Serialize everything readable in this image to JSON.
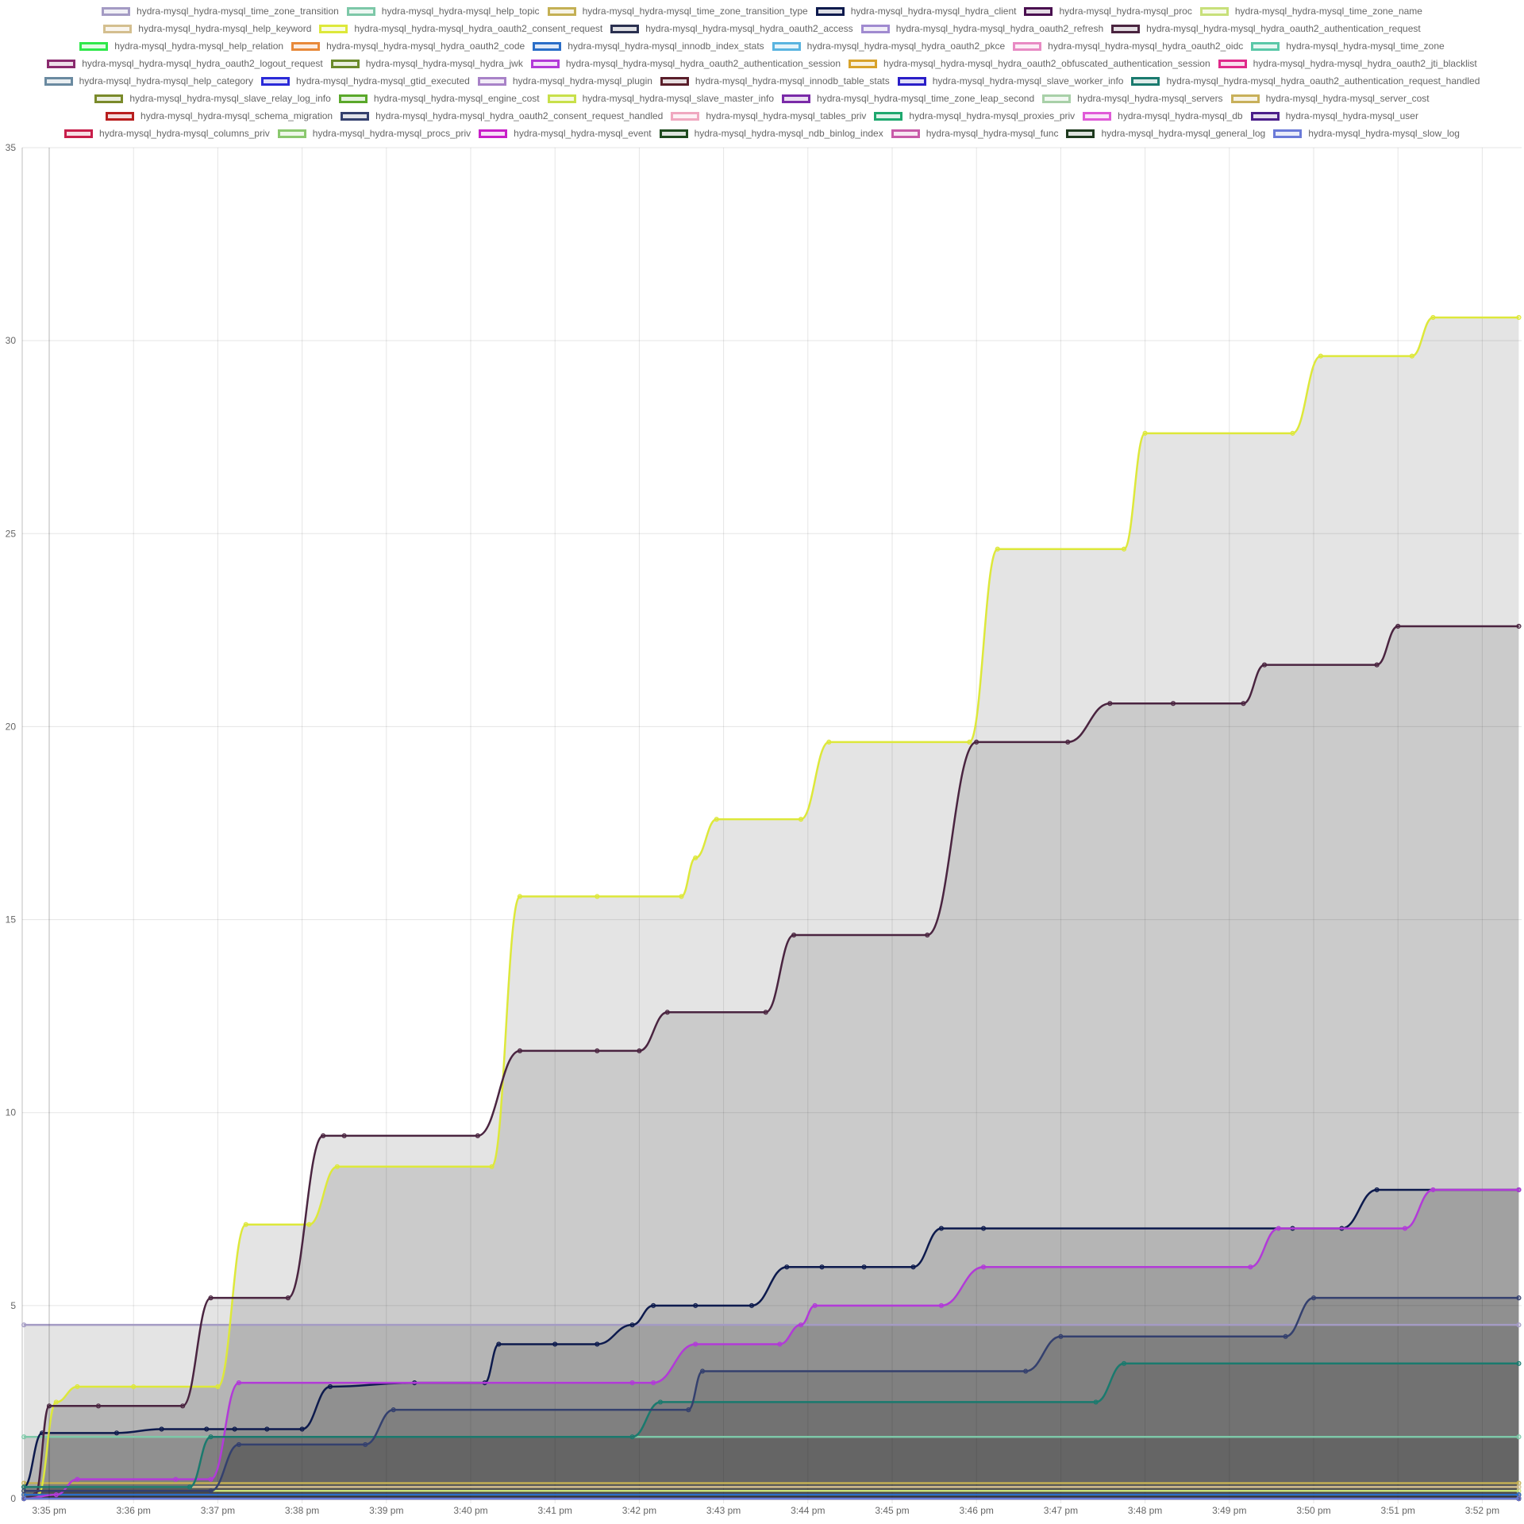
{
  "chart_data": {
    "type": "area",
    "title": "",
    "xlabel": "",
    "ylabel": "",
    "ylim": [
      0,
      35
    ],
    "y_ticks": [
      "0",
      "5",
      "10",
      "15",
      "20",
      "25",
      "30",
      "35"
    ],
    "x_ticks": [
      "3:35 pm",
      "3:36 pm",
      "3:37 pm",
      "3:38 pm",
      "3:39 pm",
      "3:40 pm",
      "3:41 pm",
      "3:42 pm",
      "3:43 pm",
      "3:44 pm",
      "3:45 pm",
      "3:46 pm",
      "3:47 pm",
      "3:48 pm",
      "3:49 pm",
      "3:50 pm",
      "3:51 pm",
      "3:52 pm"
    ],
    "x_unit": "time",
    "grid": true,
    "legend_position": "top",
    "series": [
      {
        "name": "hydra-mysql_hydra-mysql_time_zone_transition",
        "color": "#a49bc4",
        "x": [
          "3:34:42 pm",
          "3:52:26 pm"
        ],
        "y": [
          4.5,
          4.5
        ]
      },
      {
        "name": "hydra-mysql_hydra-mysql_help_topic",
        "color": "#7dc8a8",
        "x": [
          "3:34:42 pm",
          "3:52:26 pm"
        ],
        "y": [
          1.6,
          1.6
        ]
      },
      {
        "name": "hydra-mysql_hydra-mysql_time_zone_transition_type",
        "color": "#c4b054",
        "x": [
          "3:34:42 pm",
          "3:52:26 pm"
        ],
        "y": [
          0.4,
          0.4
        ]
      },
      {
        "name": "hydra-mysql_hydra-mysql_hydra_client",
        "color": "#0d1a4d",
        "x": [
          "3:34:42 pm",
          "3:34:55 pm",
          "3:35:48 pm",
          "3:36:20 pm",
          "3:36:52 pm",
          "3:37:12 pm",
          "3:37:35 pm",
          "3:38:00 pm",
          "3:38:20 pm",
          "3:39:20 pm",
          "3:40:10 pm",
          "3:40:20 pm",
          "3:41:00 pm",
          "3:41:30 pm",
          "3:41:55 pm",
          "3:42:10 pm",
          "3:42:40 pm",
          "3:43:20 pm",
          "3:43:45 pm",
          "3:44:10 pm",
          "3:44:40 pm",
          "3:45:15 pm",
          "3:45:35 pm",
          "3:46:05 pm",
          "3:49:45 pm",
          "3:50:20 pm",
          "3:50:45 pm",
          "3:52:26 pm"
        ],
        "y": [
          0.3,
          1.7,
          1.7,
          1.8,
          1.8,
          1.8,
          1.8,
          1.8,
          2.9,
          3.0,
          3.0,
          4.0,
          4.0,
          4.0,
          4.5,
          5.0,
          5.0,
          5.0,
          6.0,
          6.0,
          6.0,
          6.0,
          7.0,
          7.0,
          7.0,
          7.0,
          8.0,
          8.0
        ]
      },
      {
        "name": "hydra-mysql_hydra-mysql_proc",
        "color": "#4a1050",
        "x": [
          "3:34:42 pm",
          "3:52:26 pm"
        ],
        "y": [
          0.1,
          0.1
        ]
      },
      {
        "name": "hydra-mysql_hydra-mysql_time_zone_name",
        "color": "#c8e07a",
        "x": [
          "3:34:42 pm",
          "3:52:26 pm"
        ],
        "y": [
          0.2,
          0.2
        ]
      },
      {
        "name": "hydra-mysql_hydra-mysql_help_keyword",
        "color": "#d4bf8f",
        "x": [
          "3:34:42 pm",
          "3:52:26 pm"
        ],
        "y": [
          0.3,
          0.3
        ]
      },
      {
        "name": "hydra-mysql_hydra-mysql_hydra_oauth2_consent_request",
        "color": "#dde83a",
        "x": [
          "3:34:42 pm",
          "3:34:52 pm",
          "3:35:05 pm",
          "3:35:20 pm",
          "3:36:00 pm",
          "3:37:00 pm",
          "3:37:20 pm",
          "3:38:05 pm",
          "3:38:25 pm",
          "3:40:15 pm",
          "3:40:35 pm",
          "3:41:30 pm",
          "3:42:30 pm",
          "3:42:40 pm",
          "3:42:55 pm",
          "3:43:55 pm",
          "3:44:15 pm",
          "3:45:55 pm",
          "3:46:15 pm",
          "3:47:45 pm",
          "3:48:00 pm",
          "3:49:45 pm",
          "3:50:05 pm",
          "3:51:10 pm",
          "3:51:25 pm",
          "3:52:26 pm"
        ],
        "y": [
          0.1,
          0.1,
          2.5,
          2.9,
          2.9,
          2.9,
          7.1,
          7.1,
          8.6,
          8.6,
          15.6,
          15.6,
          15.6,
          16.6,
          17.6,
          17.6,
          19.6,
          19.6,
          24.6,
          24.6,
          27.6,
          27.6,
          29.6,
          29.6,
          30.6,
          30.6
        ]
      },
      {
        "name": "hydra-mysql_hydra-mysql_hydra_oauth2_access",
        "color": "#2a3050",
        "x": [
          "3:34:42 pm",
          "3:52:26 pm"
        ],
        "y": [
          0.0,
          0.0
        ]
      },
      {
        "name": "hydra-mysql_hydra-mysql_hydra_oauth2_refresh",
        "color": "#a08ad0",
        "x": [
          "3:34:42 pm",
          "3:52:26 pm"
        ],
        "y": [
          0.0,
          0.0
        ]
      },
      {
        "name": "hydra-mysql_hydra-mysql_hydra_oauth2_authentication_request",
        "color": "#4a2440",
        "x": [
          "3:34:42 pm",
          "3:34:50 pm",
          "3:35:00 pm",
          "3:35:35 pm",
          "3:36:35 pm",
          "3:36:55 pm",
          "3:37:50 pm",
          "3:38:15 pm",
          "3:38:30 pm",
          "3:40:05 pm",
          "3:40:35 pm",
          "3:41:30 pm",
          "3:42:00 pm",
          "3:42:20 pm",
          "3:43:30 pm",
          "3:43:50 pm",
          "3:45:25 pm",
          "3:46:00 pm",
          "3:47:05 pm",
          "3:47:35 pm",
          "3:48:20 pm",
          "3:49:10 pm",
          "3:49:25 pm",
          "3:50:45 pm",
          "3:51:00 pm",
          "3:52:26 pm"
        ],
        "y": [
          0.0,
          0.1,
          2.4,
          2.4,
          2.4,
          5.2,
          5.2,
          9.4,
          9.4,
          9.4,
          11.6,
          11.6,
          11.6,
          12.6,
          12.6,
          14.6,
          14.6,
          19.6,
          19.6,
          20.6,
          20.6,
          20.6,
          21.6,
          21.6,
          22.6,
          22.6
        ]
      },
      {
        "name": "hydra-mysql_hydra-mysql_help_relation",
        "color": "#2ee84a",
        "x": [
          "3:34:42 pm",
          "3:52:26 pm"
        ],
        "y": [
          0.0,
          0.0
        ]
      },
      {
        "name": "hydra-mysql_hydra-mysql_hydra_oauth2_code",
        "color": "#e8893a",
        "x": [
          "3:34:42 pm",
          "3:52:26 pm"
        ],
        "y": [
          0.1,
          0.1
        ]
      },
      {
        "name": "hydra-mysql_hydra-mysql_innodb_index_stats",
        "color": "#2a6ec8",
        "x": [
          "3:34:42 pm",
          "3:52:26 pm"
        ],
        "y": [
          0.1,
          0.1
        ]
      },
      {
        "name": "hydra-mysql_hydra-mysql_hydra_oauth2_pkce",
        "color": "#5ab4e0",
        "x": [
          "3:34:42 pm",
          "3:52:26 pm"
        ],
        "y": [
          0.0,
          0.0
        ]
      },
      {
        "name": "hydra-mysql_hydra-mysql_hydra_oauth2_oidc",
        "color": "#e88ac4",
        "x": [
          "3:34:42 pm",
          "3:52:26 pm"
        ],
        "y": [
          0.0,
          0.0
        ]
      },
      {
        "name": "hydra-mysql_hydra-mysql_time_zone",
        "color": "#5ac8a8",
        "x": [
          "3:34:42 pm",
          "3:52:26 pm"
        ],
        "y": [
          0.0,
          0.0
        ]
      },
      {
        "name": "hydra-mysql_hydra-mysql_hydra_oauth2_logout_request",
        "color": "#8a2a6e",
        "x": [
          "3:34:42 pm",
          "3:52:26 pm"
        ],
        "y": [
          0.0,
          0.0
        ]
      },
      {
        "name": "hydra-mysql_hydra-mysql_hydra_jwk",
        "color": "#6a8a2a",
        "x": [
          "3:34:42 pm",
          "3:52:26 pm"
        ],
        "y": [
          0.0,
          0.0
        ]
      },
      {
        "name": "hydra-mysql_hydra-mysql_hydra_oauth2_authentication_session",
        "color": "#b23ad8",
        "x": [
          "3:34:42 pm",
          "3:35:05 pm",
          "3:35:20 pm",
          "3:36:30 pm",
          "3:36:55 pm",
          "3:37:15 pm",
          "3:41:55 pm",
          "3:42:10 pm",
          "3:42:40 pm",
          "3:43:40 pm",
          "3:43:55 pm",
          "3:44:05 pm",
          "3:45:35 pm",
          "3:46:05 pm",
          "3:49:15 pm",
          "3:49:35 pm",
          "3:51:05 pm",
          "3:51:25 pm",
          "3:52:26 pm"
        ],
        "y": [
          0.0,
          0.1,
          0.5,
          0.5,
          0.5,
          3.0,
          3.0,
          3.0,
          4.0,
          4.0,
          4.5,
          5.0,
          5.0,
          6.0,
          6.0,
          7.0,
          7.0,
          8.0,
          8.0
        ]
      },
      {
        "name": "hydra-mysql_hydra-mysql_hydra_oauth2_obfuscated_authentication_session",
        "color": "#d8a22a",
        "x": [
          "3:34:42 pm",
          "3:52:26 pm"
        ],
        "y": [
          0.0,
          0.0
        ]
      },
      {
        "name": "hydra-mysql_hydra-mysql_hydra_oauth2_jti_blacklist",
        "color": "#e02a8a",
        "x": [
          "3:34:42 pm",
          "3:52:26 pm"
        ],
        "y": [
          0.0,
          0.0
        ]
      },
      {
        "name": "hydra-mysql_hydra-mysql_help_category",
        "color": "#6a8aa0",
        "x": [
          "3:34:42 pm",
          "3:52:26 pm"
        ],
        "y": [
          0.0,
          0.0
        ]
      },
      {
        "name": "hydra-mysql_hydra-mysql_gtid_executed",
        "color": "#2a2ad8",
        "x": [
          "3:34:42 pm",
          "3:52:26 pm"
        ],
        "y": [
          0.0,
          0.0
        ]
      },
      {
        "name": "hydra-mysql_hydra-mysql_plugin",
        "color": "#a882c8",
        "x": [
          "3:34:42 pm",
          "3:52:26 pm"
        ],
        "y": [
          0.0,
          0.0
        ]
      },
      {
        "name": "hydra-mysql_hydra-mysql_innodb_table_stats",
        "color": "#5a1e2a",
        "x": [
          "3:34:42 pm",
          "3:52:26 pm"
        ],
        "y": [
          0.0,
          0.0
        ]
      },
      {
        "name": "hydra-mysql_hydra-mysql_slave_worker_info",
        "color": "#2a1ec8",
        "x": [
          "3:34:42 pm",
          "3:52:26 pm"
        ],
        "y": [
          0.0,
          0.0
        ]
      },
      {
        "name": "hydra-mysql_hydra-mysql_hydra_oauth2_authentication_request_handled",
        "color": "#1a7a6e",
        "x": [
          "3:34:42 pm",
          "3:36:40 pm",
          "3:36:55 pm",
          "3:41:55 pm",
          "3:42:15 pm",
          "3:47:25 pm",
          "3:47:45 pm",
          "3:52:26 pm"
        ],
        "y": [
          0.3,
          0.3,
          1.6,
          1.6,
          2.5,
          2.5,
          3.5,
          3.5
        ]
      },
      {
        "name": "hydra-mysql_hydra-mysql_slave_relay_log_info",
        "color": "#7a8a2a",
        "x": [
          "3:34:42 pm",
          "3:52:26 pm"
        ],
        "y": [
          0.0,
          0.0
        ]
      },
      {
        "name": "hydra-mysql_hydra-mysql_engine_cost",
        "color": "#5aa82a",
        "x": [
          "3:34:42 pm",
          "3:52:26 pm"
        ],
        "y": [
          0.0,
          0.0
        ]
      },
      {
        "name": "hydra-mysql_hydra-mysql_slave_master_info",
        "color": "#c8e04a",
        "x": [
          "3:34:42 pm",
          "3:52:26 pm"
        ],
        "y": [
          0.0,
          0.0
        ]
      },
      {
        "name": "hydra-mysql_hydra-mysql_time_zone_leap_second",
        "color": "#7a2aa8",
        "x": [
          "3:34:42 pm",
          "3:52:26 pm"
        ],
        "y": [
          0.0,
          0.0
        ]
      },
      {
        "name": "hydra-mysql_hydra-mysql_servers",
        "color": "#a8d0a8",
        "x": [
          "3:34:42 pm",
          "3:52:26 pm"
        ],
        "y": [
          0.0,
          0.0
        ]
      },
      {
        "name": "hydra-mysql_hydra-mysql_server_cost",
        "color": "#c8b05a",
        "x": [
          "3:34:42 pm",
          "3:52:26 pm"
        ],
        "y": [
          0.0,
          0.0
        ]
      },
      {
        "name": "hydra-mysql_hydra-mysql_schema_migration",
        "color": "#b81e1e",
        "x": [
          "3:34:42 pm",
          "3:52:26 pm"
        ],
        "y": [
          0.0,
          0.0
        ]
      },
      {
        "name": "hydra-mysql_hydra-mysql_hydra_oauth2_consent_request_handled",
        "color": "#34406e",
        "x": [
          "3:34:42 pm",
          "3:36:55 pm",
          "3:37:15 pm",
          "3:38:45 pm",
          "3:39:05 pm",
          "3:42:35 pm",
          "3:42:45 pm",
          "3:46:35 pm",
          "3:47:00 pm",
          "3:49:40 pm",
          "3:50:00 pm",
          "3:52:26 pm"
        ],
        "y": [
          0.2,
          0.2,
          1.4,
          1.4,
          2.3,
          2.3,
          3.3,
          3.3,
          4.2,
          4.2,
          5.2,
          5.2
        ]
      },
      {
        "name": "hydra-mysql_hydra-mysql_tables_priv",
        "color": "#f0a8c0",
        "x": [
          "3:34:42 pm",
          "3:52:26 pm"
        ],
        "y": [
          0.0,
          0.0
        ]
      },
      {
        "name": "hydra-mysql_hydra-mysql_proxies_priv",
        "color": "#1ea86e",
        "x": [
          "3:34:42 pm",
          "3:52:26 pm"
        ],
        "y": [
          0.0,
          0.0
        ]
      },
      {
        "name": "hydra-mysql_hydra-mysql_db",
        "color": "#e05ad8",
        "x": [
          "3:34:42 pm",
          "3:52:26 pm"
        ],
        "y": [
          0.0,
          0.0
        ]
      },
      {
        "name": "hydra-mysql_hydra-mysql_user",
        "color": "#4a1e8a",
        "x": [
          "3:34:42 pm",
          "3:52:26 pm"
        ],
        "y": [
          0.0,
          0.0
        ]
      },
      {
        "name": "hydra-mysql_hydra-mysql_columns_priv",
        "color": "#c81e4a",
        "x": [
          "3:34:42 pm",
          "3:52:26 pm"
        ],
        "y": [
          0.0,
          0.0
        ]
      },
      {
        "name": "hydra-mysql_hydra-mysql_procs_priv",
        "color": "#8ac86e",
        "x": [
          "3:34:42 pm",
          "3:52:26 pm"
        ],
        "y": [
          0.0,
          0.0
        ]
      },
      {
        "name": "hydra-mysql_hydra-mysql_event",
        "color": "#c81ec8",
        "x": [
          "3:34:42 pm",
          "3:52:26 pm"
        ],
        "y": [
          0.0,
          0.0
        ]
      },
      {
        "name": "hydra-mysql_hydra-mysql_ndb_binlog_index",
        "color": "#1e4a1e",
        "x": [
          "3:34:42 pm",
          "3:52:26 pm"
        ],
        "y": [
          0.0,
          0.0
        ]
      },
      {
        "name": "hydra-mysql_hydra-mysql_func",
        "color": "#c85aa8",
        "x": [
          "3:34:42 pm",
          "3:52:26 pm"
        ],
        "y": [
          0.0,
          0.0
        ]
      },
      {
        "name": "hydra-mysql_hydra-mysql_general_log",
        "color": "#1e3a1e",
        "x": [
          "3:34:42 pm",
          "3:52:26 pm"
        ],
        "y": [
          0.0,
          0.0
        ]
      },
      {
        "name": "hydra-mysql_hydra-mysql_slow_log",
        "color": "#6a7ad8",
        "x": [
          "3:34:42 pm",
          "3:52:26 pm"
        ],
        "y": [
          0.0,
          0.0
        ]
      }
    ]
  }
}
